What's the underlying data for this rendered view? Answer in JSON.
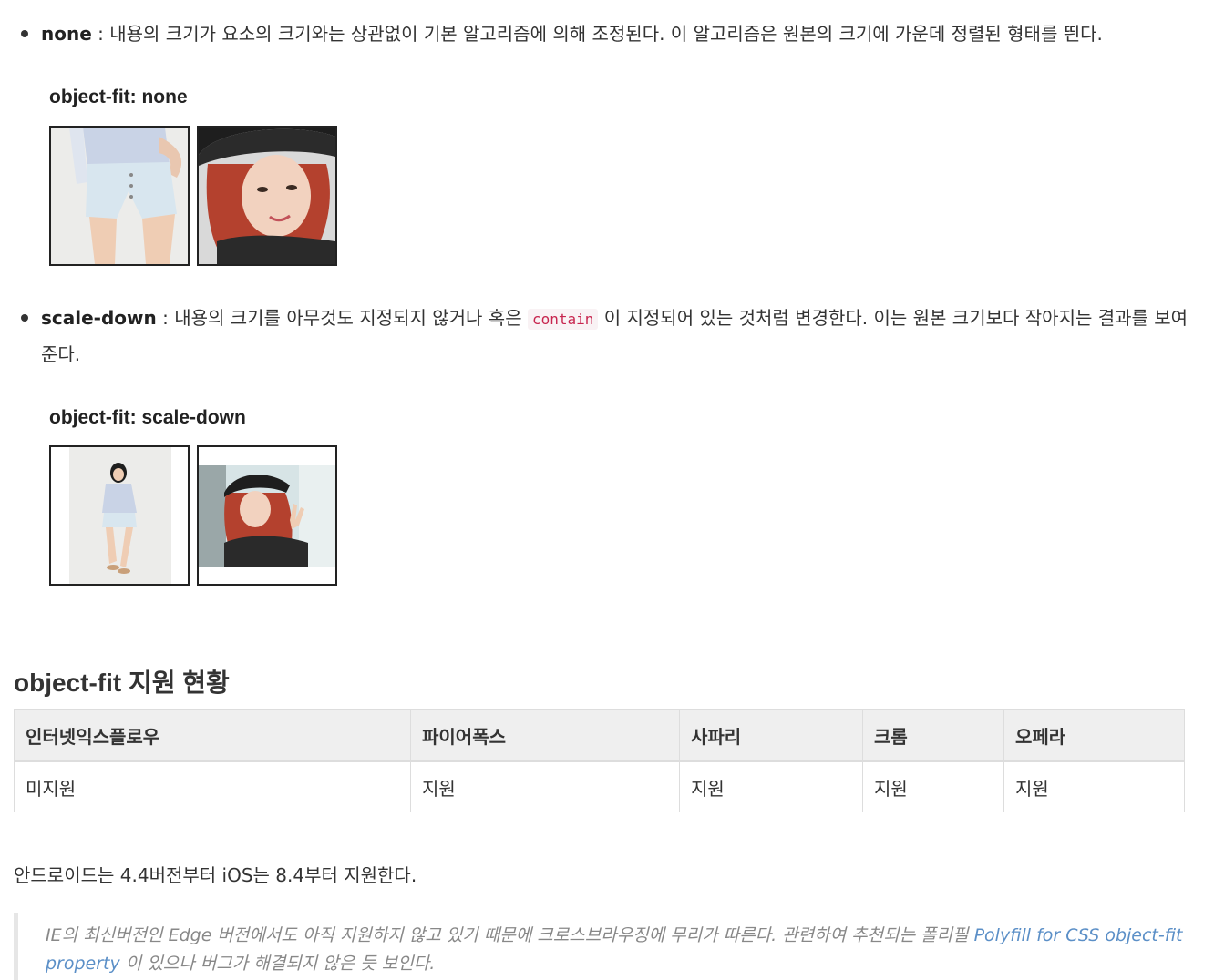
{
  "items": {
    "none": {
      "term": "none",
      "text": " : 내용의 크기가 요소의 크기와는 상관없이 기본 알고리즘에 의해 조정된다. 이 알고리즘은 원본의 크기에 가운데 정렬된 형태를 띈다."
    },
    "scale_down": {
      "term": "scale-down",
      "text_before": " : 내용의 크기를 아무것도 지정되지 않거나 혹은 ",
      "code": "contain",
      "text_after": " 이 지정되어 있는 것처럼 변경한다. 이는 원본 크기보다 작아지는 결과를 보여준다."
    }
  },
  "figures": {
    "none_title": "object-fit: none",
    "scale_down_title": "object-fit: scale-down"
  },
  "section": {
    "title": "object-fit 지원 현황"
  },
  "table": {
    "headers": [
      "인터넷익스플로우",
      "파이어폭스",
      "사파리",
      "크롬",
      "오페라"
    ],
    "row": [
      "미지원",
      "지원",
      "지원",
      "지원",
      "지원"
    ]
  },
  "paragraph": "안드로이드는 4.4버전부터 iOS는 8.4부터 지원한다.",
  "blockquote": {
    "text_before": "IE의 최신버전인 Edge 버전에서도 아직 지원하지 않고 있기 때문에 크로스브라우징에 무리가 따른다. 관련하여 추천되는 폴리필 ",
    "link": "Polyfill for CSS object-fit property",
    "text_after": " 이 있으나 버그가 해결되지 않은 듯 보인다."
  },
  "colors": {
    "text": "#333333",
    "code_text": "#c7254e",
    "code_bg": "#f9f2f4",
    "link": "#5b8fc7",
    "table_header_bg": "#efefef"
  }
}
